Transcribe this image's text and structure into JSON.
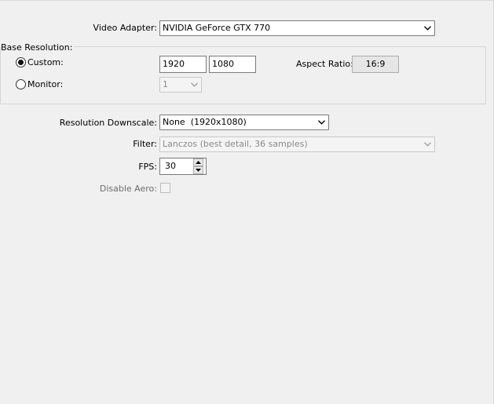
{
  "video_adapter": {
    "label": "Video Adapter:",
    "value": "NVIDIA GeForce GTX 770",
    "arrow_icon": "chevron-down"
  },
  "base_resolution": {
    "group_title": "Base Resolution:",
    "custom_label": "Custom:",
    "custom_selected": true,
    "width_value": "1920",
    "height_value": "1080",
    "aspect_ratio_label": "Aspect Ratio:",
    "aspect_ratio_value": "16:9",
    "monitor_label": "Monitor:",
    "monitor_selected": false,
    "monitor_value": "1"
  },
  "downscale": {
    "label": "Resolution Downscale:",
    "value": "None  (1920x1080)"
  },
  "filter": {
    "label": "Filter:",
    "value": "Lanczos (best detail, 36 samples)",
    "enabled": false
  },
  "fps": {
    "label": "FPS:",
    "value": "30"
  },
  "disable_aero": {
    "label": "Disable Aero:",
    "checked": false,
    "enabled": false
  },
  "colors": {
    "background": "#f0f0f0",
    "border": "#7a7a7a",
    "disabled_text": "#6d6d6d"
  }
}
